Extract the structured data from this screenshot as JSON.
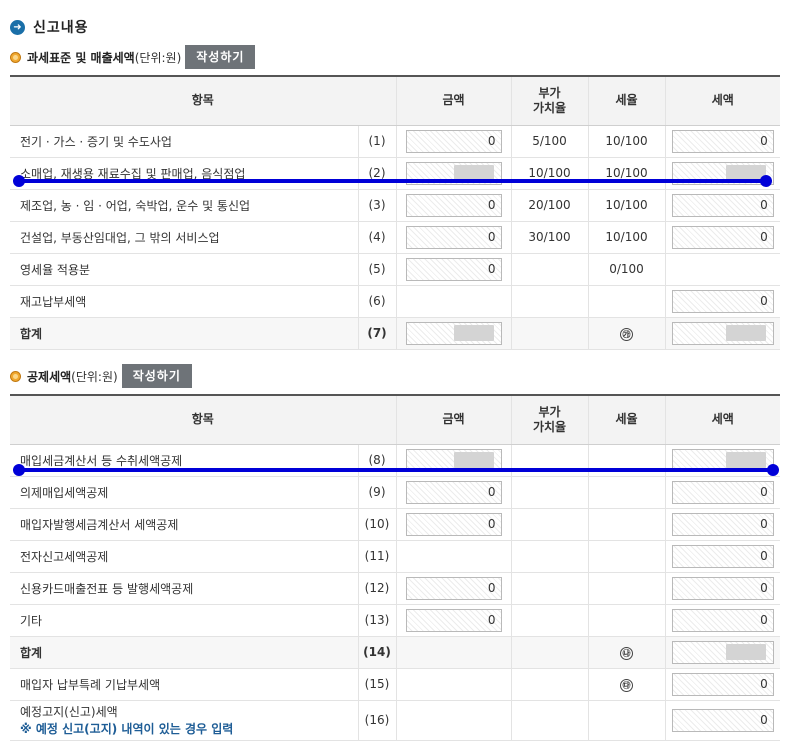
{
  "page_title": "신고내용",
  "section1": {
    "title": "과세표준 및 매출세액",
    "unit": "(단위:원)",
    "button": "작성하기",
    "headers": [
      "항목",
      "금액",
      "부가\n가치율",
      "세율",
      "세액"
    ],
    "rows": [
      {
        "label": "전기 · 가스 · 증기 및 수도사업",
        "num": "(1)",
        "amount": "0",
        "rate": "5/100",
        "tax_rate": "10/100",
        "tax": "0"
      },
      {
        "label": "소매업, 재생용 재료수집 및 판매업, 음식점업",
        "num": "(2)",
        "amount": "",
        "rate": "10/100",
        "tax_rate": "10/100",
        "tax": ""
      },
      {
        "label": "제조업, 농 · 임 · 어업, 숙박업, 운수 및 통신업",
        "num": "(3)",
        "amount": "0",
        "rate": "20/100",
        "tax_rate": "10/100",
        "tax": "0"
      },
      {
        "label": "건설업, 부동산임대업, 그 밖의 서비스업",
        "num": "(4)",
        "amount": "0",
        "rate": "30/100",
        "tax_rate": "10/100",
        "tax": "0"
      },
      {
        "label": "영세율 적용분",
        "num": "(5)",
        "amount": "0",
        "rate": "",
        "tax_rate": "0/100",
        "tax": null
      },
      {
        "label": "재고납부세액",
        "num": "(6)",
        "amount": null,
        "rate": "",
        "tax_rate": "",
        "tax": "0"
      },
      {
        "label": "합계",
        "num": "(7)",
        "amount": "",
        "rate": "",
        "tax_rate": "㉮",
        "tax": ""
      }
    ]
  },
  "section2": {
    "title": "공제세액",
    "unit": "(단위:원)",
    "button": "작성하기",
    "headers": [
      "항목",
      "금액",
      "부가\n가치율",
      "세율",
      "세액"
    ],
    "rows": [
      {
        "label": "매입세금계산서 등 수취세액공제",
        "num": "(8)",
        "amount": "",
        "tax_rate": "",
        "tax": ""
      },
      {
        "label": "의제매입세액공제",
        "num": "(9)",
        "amount": "0",
        "tax_rate": "",
        "tax": "0"
      },
      {
        "label": "매입자발행세금계산서 세액공제",
        "num": "(10)",
        "amount": "0",
        "tax_rate": "",
        "tax": "0"
      },
      {
        "label": "전자신고세액공제",
        "num": "(11)",
        "amount": null,
        "tax_rate": "",
        "tax": "0"
      },
      {
        "label": "신용카드매출전표 등 발행세액공제",
        "num": "(12)",
        "amount": "0",
        "tax_rate": "",
        "tax": "0"
      },
      {
        "label": "기타",
        "num": "(13)",
        "amount": "0",
        "tax_rate": "",
        "tax": "0"
      },
      {
        "label": "합계",
        "num": "(14)",
        "amount": null,
        "tax_rate": "㉯",
        "tax": ""
      },
      {
        "label": "매입자 납부특례 기납부세액",
        "num": "(15)",
        "amount": null,
        "tax_rate": "㉰",
        "tax": "0"
      },
      {
        "label": "예정고지(신고)세액",
        "note": "※ 예정 신고(고지) 내역이 있는 경우 입력",
        "num": "(16)",
        "amount": null,
        "tax_rate": "",
        "tax": "0"
      }
    ]
  },
  "colors": {
    "accent_line": "#0000d8",
    "button_bg": "#6e7378",
    "note_text": "#1e5d96"
  },
  "icons": [
    "arrow-right-circle-icon",
    "bullet-dot-icon"
  ]
}
